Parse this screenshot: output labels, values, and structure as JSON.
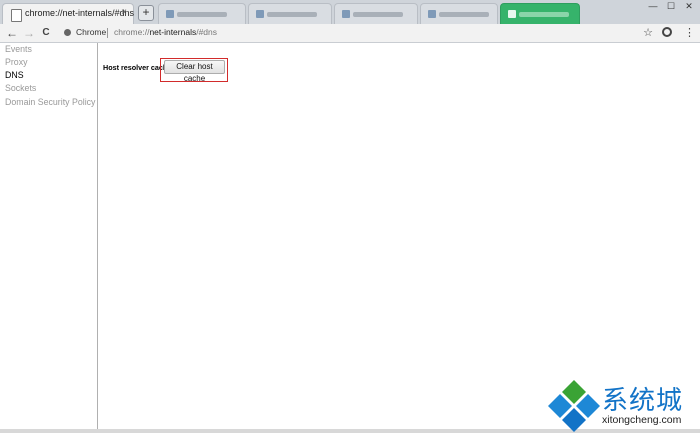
{
  "tabs": {
    "active_title": "chrome://net-internals/#dns",
    "close_glyph": "×",
    "new_tab_glyph": "+"
  },
  "window_controls": {
    "minimize": "—",
    "maximize": "☐",
    "close": "✕"
  },
  "toolbar": {
    "back_glyph": "←",
    "forward_glyph": "→",
    "reload_glyph": "C",
    "site_chip": "Chrome",
    "url_scheme": "chrome://",
    "url_host": "net-internals",
    "url_path": "/#dns",
    "star_glyph": "☆",
    "menu_glyph": "⋮"
  },
  "sidebar": {
    "items": [
      {
        "label": "Events",
        "active": false
      },
      {
        "label": "Proxy",
        "active": false
      },
      {
        "label": "DNS",
        "active": true
      },
      {
        "label": "Sockets",
        "active": false
      },
      {
        "label": "Domain Security Policy",
        "active": false
      }
    ]
  },
  "main": {
    "resolver_label": "Host resolver cache",
    "clear_button_label": "Clear host cache"
  },
  "watermark": {
    "brand": "系统城",
    "domain": "xitongcheng.com"
  },
  "colors": {
    "highlight": "#d22b2b",
    "brand_blue": "#1273c7",
    "brand_green": "#3aa335"
  }
}
